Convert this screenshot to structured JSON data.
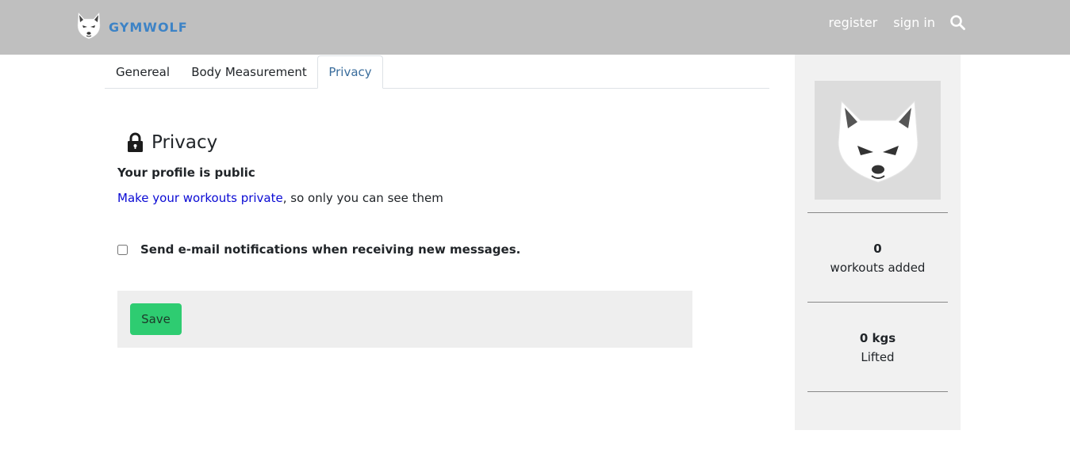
{
  "header": {
    "brand_name": "GYMWOLF",
    "brand_color": "#3d83c6",
    "background": "#bfbfbf",
    "nav": {
      "register_label": "register",
      "signin_label": "sign in",
      "search_icon": "search-icon"
    }
  },
  "tabs": [
    {
      "label": "Genereal",
      "active": false
    },
    {
      "label": "Body Measurement",
      "active": false
    },
    {
      "label": "Privacy",
      "active": true
    }
  ],
  "privacy": {
    "title": "Privacy",
    "title_icon": "lock-icon",
    "status": "Your profile is public",
    "link_text": "Make your workouts private",
    "link_suffix": ", so only you can see them",
    "link_color": "#0a0ad4",
    "notification_label": "Send e-mail notifications when receiving new messages.",
    "notification_checked": false,
    "save_label": "Save",
    "save_color": "#2ecc71"
  },
  "sidebar": {
    "avatar_icon": "wolf-avatar-icon",
    "stats": [
      {
        "value": "0",
        "label": "workouts added"
      },
      {
        "value": "0 kgs",
        "label": "Lifted"
      }
    ]
  }
}
